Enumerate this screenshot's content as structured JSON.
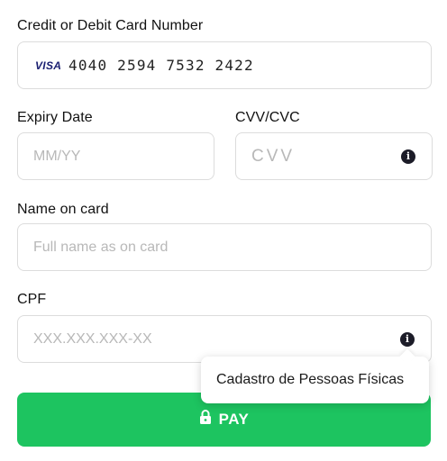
{
  "card_number": {
    "label": "Credit or Debit Card Number",
    "brand": "VISA",
    "value": "4040 2594 7532 2422"
  },
  "expiry": {
    "label": "Expiry Date",
    "placeholder": "MM/YY"
  },
  "cvv": {
    "label": "CVV/CVC",
    "placeholder": "CVV",
    "info_icon": "info-icon"
  },
  "name": {
    "label": "Name on card",
    "placeholder": "Full name as on card"
  },
  "cpf": {
    "label": "CPF",
    "placeholder": "XXX.XXX.XXX-XX",
    "info_icon": "info-icon",
    "tooltip": "Cadastro de Pessoas Físicas"
  },
  "pay_button": {
    "label": "PAY",
    "icon": "lock-icon",
    "color": "#1dc460"
  }
}
